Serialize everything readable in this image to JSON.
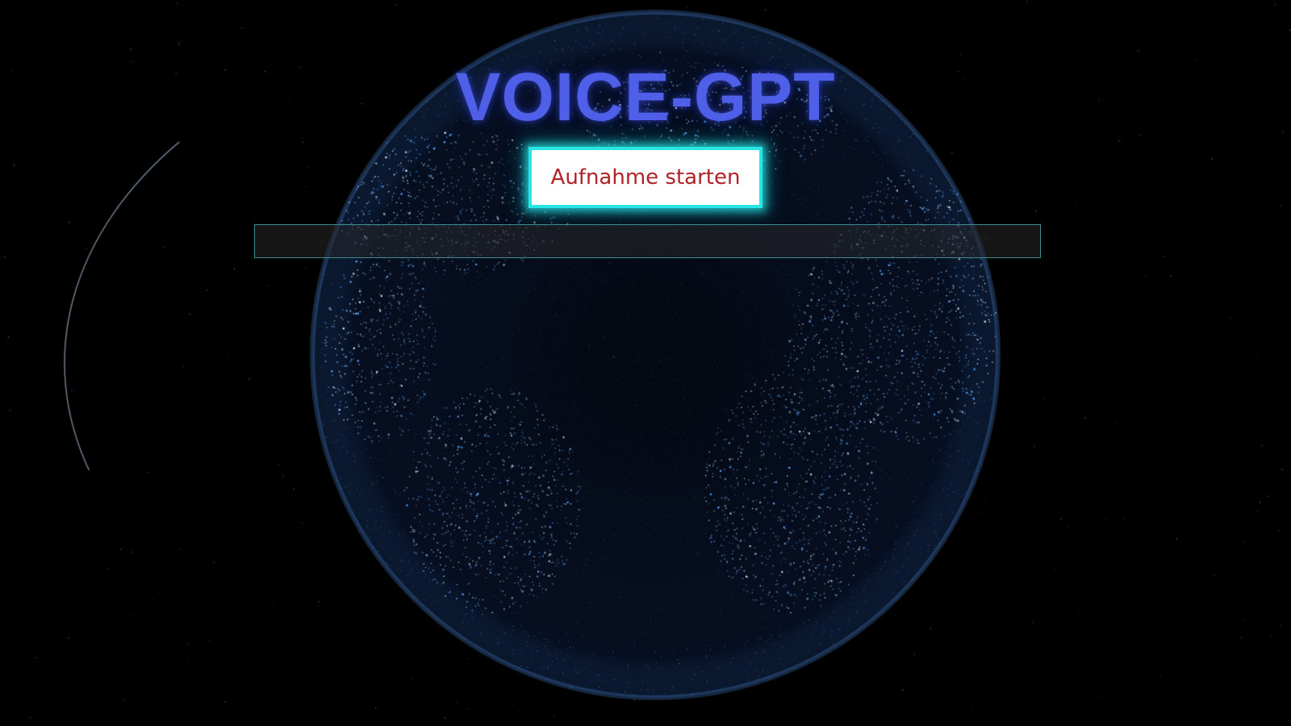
{
  "app": {
    "title": "VOICE-GPT"
  },
  "controls": {
    "record_button_label": "Aufnahme starten",
    "transcript_value": ""
  },
  "background": {
    "description_icon": "earth-globe-image"
  },
  "colors": {
    "title": "#4f5fe8",
    "button_text": "#b02228",
    "button_glow": "#28e6e6",
    "field_border": "#3f8c92",
    "globe_light": "#5aa8ff",
    "page_background": "#000000"
  }
}
